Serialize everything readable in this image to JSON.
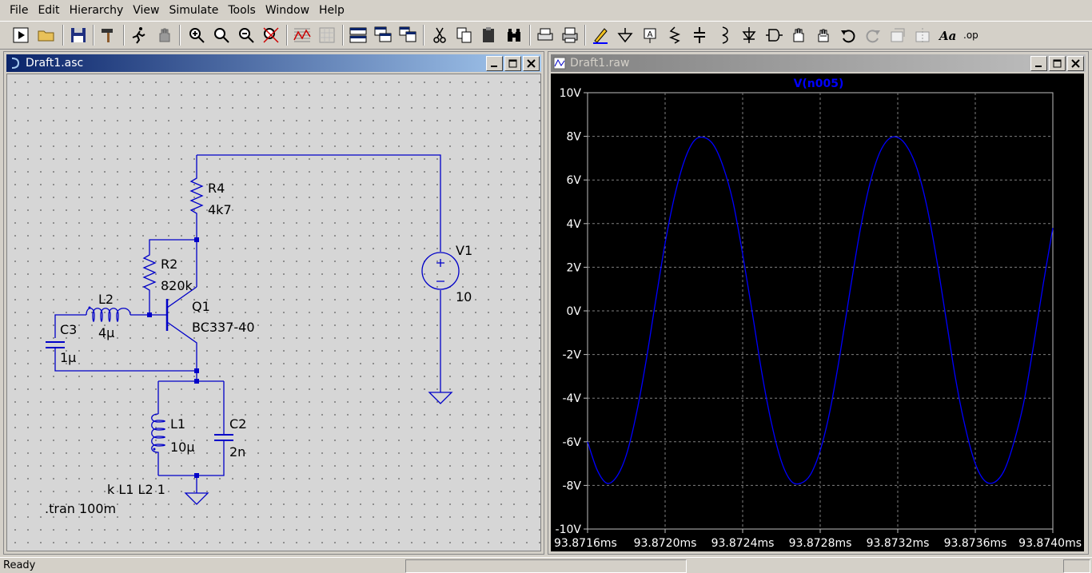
{
  "menu": [
    "File",
    "Edit",
    "Hierarchy",
    "View",
    "Simulate",
    "Tools",
    "Window",
    "Help"
  ],
  "schematic_window": {
    "title": "Draft1.asc",
    "components": {
      "r4": {
        "name": "R4",
        "value": "4k7"
      },
      "r2": {
        "name": "R2",
        "value": "820k"
      },
      "q1": {
        "name": "Q1",
        "value": "BC337-40"
      },
      "l2": {
        "name": "L2",
        "value": "4µ"
      },
      "c3": {
        "name": "C3",
        "value": "1µ"
      },
      "l1": {
        "name": "L1",
        "value": "10µ"
      },
      "c2": {
        "name": "C2",
        "value": "2n"
      },
      "v1": {
        "name": "V1",
        "value": "10"
      }
    },
    "directives": {
      "coupling": "k L1 L2 1",
      "tran": ".tran 100m"
    }
  },
  "plot_window": {
    "title": "Draft1.raw",
    "trace_label": "V(n005)",
    "colors": {
      "trace": "#0000ff",
      "background": "#000000",
      "grid": "#808080",
      "label": "#0000ff"
    }
  },
  "chart_data": {
    "type": "line",
    "title": "V(n005)",
    "xlabel": "",
    "ylabel": "",
    "xlim": [
      93.8716,
      93.874
    ],
    "ylim": [
      -10,
      10
    ],
    "x_ticks": [
      "93.8716ms",
      "93.8720ms",
      "93.8724ms",
      "93.8728ms",
      "93.8732ms",
      "93.8736ms",
      "93.8740ms"
    ],
    "y_ticks": [
      "10V",
      "8V",
      "6V",
      "4V",
      "2V",
      "0V",
      "-2V",
      "-4V",
      "-6V",
      "-8V",
      "-10V"
    ],
    "grid": true,
    "series": [
      {
        "name": "V(n005)",
        "x": [
          93.8716,
          93.87165,
          93.8717,
          93.87175,
          93.8718,
          93.87185,
          93.8719,
          93.87195,
          93.872,
          93.87205,
          93.8721,
          93.87215,
          93.8722,
          93.87225,
          93.8723,
          93.87235,
          93.8724,
          93.87245,
          93.8725,
          93.87255,
          93.8726,
          93.87265,
          93.8727,
          93.87275,
          93.8728,
          93.87285,
          93.8729,
          93.87295,
          93.873,
          93.87305,
          93.8731,
          93.87315,
          93.8732,
          93.87325,
          93.8733,
          93.87335,
          93.8734,
          93.87345,
          93.8735,
          93.87355,
          93.8736,
          93.87365,
          93.8737,
          93.87375,
          93.8738,
          93.87385,
          93.8739,
          93.87395,
          93.874
        ],
        "values": [
          -6.0,
          -7.3,
          -7.9,
          -7.6,
          -6.6,
          -4.8,
          -2.4,
          0.4,
          3.1,
          5.3,
          6.9,
          7.8,
          7.95,
          7.6,
          6.6,
          5.0,
          2.6,
          -0.1,
          -2.9,
          -5.2,
          -6.9,
          -7.8,
          -7.9,
          -7.5,
          -6.4,
          -4.6,
          -2.1,
          0.7,
          3.4,
          5.6,
          7.1,
          7.85,
          7.95,
          7.5,
          6.5,
          4.8,
          2.4,
          -0.4,
          -3.2,
          -5.4,
          -7.0,
          -7.8,
          -7.85,
          -7.3,
          -6.0,
          -4.2,
          -1.6,
          1.2,
          3.8
        ]
      }
    ]
  },
  "status": {
    "text": "Ready"
  }
}
